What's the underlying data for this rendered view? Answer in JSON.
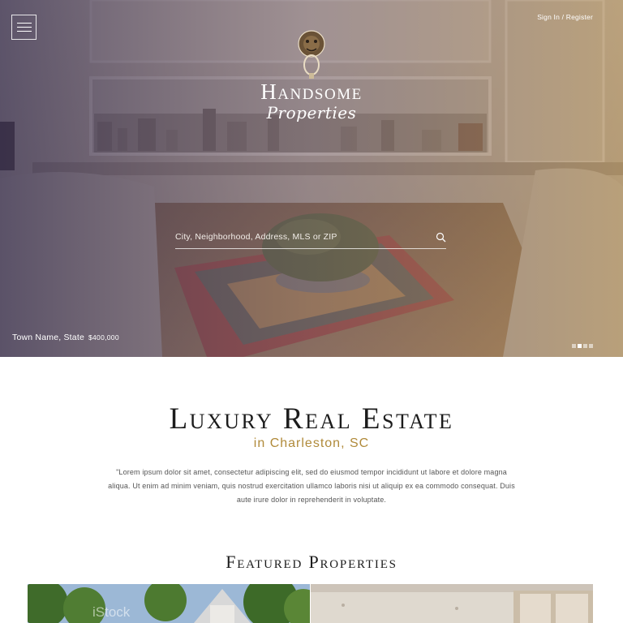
{
  "header": {
    "menu_icon": "hamburger-menu-icon",
    "signin_label": "Sign In / Register",
    "logo": {
      "line1": "Handsome",
      "line2": "Properties",
      "icon": "lion-door-knocker-icon"
    }
  },
  "hero": {
    "search_placeholder": "City, Neighborhood, Address, MLS or ZIP",
    "search_value": "",
    "search_icon": "search-icon",
    "location": "Town Name, State",
    "price": "$400,000",
    "slides_total": 4,
    "slides_active": 2
  },
  "intro": {
    "title": "Luxury Real Estate",
    "subtitle": "in Charleston, SC",
    "description": "\"Lorem ipsum dolor sit amet, consectetur adipiscing elit, sed do eiusmod tempor incididunt ut labore et dolore magna aliqua. Ut enim ad minim veniam, quis nostrud exercitation ullamco laboris nisi ut aliquip ex ea commodo consequat. Duis aute irure dolor in reprehenderit in voluptate."
  },
  "featured": {
    "title": "Featured Properties",
    "cards": [
      {
        "watermark": "iStock"
      },
      {
        "watermark": ""
      }
    ]
  },
  "colors": {
    "accent_gold": "#b08a3a",
    "hero_overlay_left": "#3e3552",
    "hero_overlay_right": "#9c7c52",
    "heading_text": "#1c1c1c",
    "body_text": "#555555"
  }
}
